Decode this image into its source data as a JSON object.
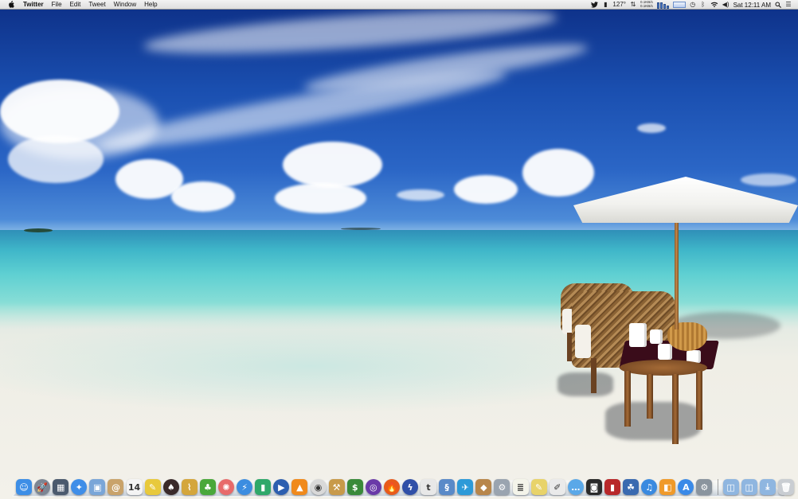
{
  "menubar": {
    "app_name": "Twitter",
    "menus": [
      "File",
      "Edit",
      "Tweet",
      "Window",
      "Help"
    ],
    "status": {
      "temperature": "127°",
      "net_up": "0.1KB/s",
      "net_down": "0.1KB/s",
      "clock": "Sat 12:11 AM"
    }
  },
  "dock": {
    "apps": [
      {
        "name": "finder-icon",
        "glyph": "☺",
        "bg": "#3d8ee6",
        "round": false
      },
      {
        "name": "launchpad-icon",
        "glyph": "🚀",
        "bg": "#7c8593",
        "round": true
      },
      {
        "name": "mission-control-icon",
        "glyph": "▦",
        "bg": "#4b5a6e",
        "round": false
      },
      {
        "name": "safari-icon",
        "glyph": "✦",
        "bg": "#3f8ee8",
        "round": true
      },
      {
        "name": "preview-icon",
        "glyph": "▣",
        "bg": "#7aa6d8",
        "round": false
      },
      {
        "name": "address-book-icon",
        "glyph": "@",
        "bg": "#c9a36b",
        "round": false
      },
      {
        "name": "calendar-icon",
        "glyph": "14",
        "bg": "#f4f4f4",
        "round": false
      },
      {
        "name": "stickies-icon",
        "glyph": "✎",
        "bg": "#e8c93c",
        "round": false
      },
      {
        "name": "alfred-hat-icon",
        "glyph": "♠",
        "bg": "#3a2a2a",
        "round": true
      },
      {
        "name": "paperclip-icon",
        "glyph": "⌇",
        "bg": "#d4a63c",
        "round": false
      },
      {
        "name": "evernote-icon",
        "glyph": "♣",
        "bg": "#4aa83a",
        "round": false
      },
      {
        "name": "pinwheel-icon",
        "glyph": "✺",
        "bg": "#e86a6a",
        "round": true
      },
      {
        "name": "reeder-icon",
        "glyph": "⚡",
        "bg": "#3c8de0",
        "round": true
      },
      {
        "name": "bottle-icon",
        "glyph": "▮",
        "bg": "#2fa86a",
        "round": false
      },
      {
        "name": "quicktime-icon",
        "glyph": "▶",
        "bg": "#2d5fb0",
        "round": true
      },
      {
        "name": "vlc-icon",
        "glyph": "▲",
        "bg": "#f08a1c",
        "round": false
      },
      {
        "name": "chrome-icon",
        "glyph": "◉",
        "bg": "#d9d9d9",
        "round": true
      },
      {
        "name": "hammer-icon",
        "glyph": "⚒",
        "bg": "#c89a4a",
        "round": false
      },
      {
        "name": "money-icon",
        "glyph": "$",
        "bg": "#3a8a3a",
        "round": false
      },
      {
        "name": "dvd-icon",
        "glyph": "◎",
        "bg": "#6a3aa8",
        "round": true
      },
      {
        "name": "firefox-icon",
        "glyph": "🔥",
        "bg": "#e85a1c",
        "round": true
      },
      {
        "name": "thunder-icon",
        "glyph": "ϟ",
        "bg": "#3050a8",
        "round": true
      },
      {
        "name": "textedit-icon",
        "glyph": "t",
        "bg": "#e8e8e8",
        "round": false
      },
      {
        "name": "dna-icon",
        "glyph": "§",
        "bg": "#5a8ac8",
        "round": false
      },
      {
        "name": "twitter-icon",
        "glyph": "✈",
        "bg": "#2d9ad8",
        "round": false
      },
      {
        "name": "package-icon",
        "glyph": "◆",
        "bg": "#b8864a",
        "round": false
      },
      {
        "name": "utility-icon",
        "glyph": "⚙",
        "bg": "#9aa4b0",
        "round": false
      },
      {
        "name": "notepad-icon",
        "glyph": "≣",
        "bg": "#f4f4ea",
        "round": false
      },
      {
        "name": "notes-icon",
        "glyph": "✎",
        "bg": "#e8d36a",
        "round": false
      },
      {
        "name": "editor-icon",
        "glyph": "✐",
        "bg": "#eaeaea",
        "round": false
      },
      {
        "name": "messages-icon",
        "glyph": "…",
        "bg": "#5aa8e8",
        "round": true
      },
      {
        "name": "photo-booth-icon",
        "glyph": "◙",
        "bg": "#2a2a2a",
        "round": false
      },
      {
        "name": "photoshop-icon",
        "glyph": "▮",
        "bg": "#b8282a",
        "round": false
      },
      {
        "name": "photos-icon",
        "glyph": "☘",
        "bg": "#3a6ab0",
        "round": false
      },
      {
        "name": "itunes-icon",
        "glyph": "♫",
        "bg": "#3a8ae0",
        "round": true
      },
      {
        "name": "ibooks-icon",
        "glyph": "◧",
        "bg": "#f09a2a",
        "round": false
      },
      {
        "name": "app-store-icon",
        "glyph": "A",
        "bg": "#3a8ae8",
        "round": true
      },
      {
        "name": "system-preferences-icon",
        "glyph": "⚙",
        "bg": "#8a949e",
        "round": false
      }
    ],
    "stacks": [
      {
        "name": "applications-folder-icon",
        "glyph": "◫",
        "bg": "#8fb6e0"
      },
      {
        "name": "documents-folder-icon",
        "glyph": "◫",
        "bg": "#8fb6e0"
      },
      {
        "name": "downloads-folder-icon",
        "glyph": "⤓",
        "bg": "#8fb6e0"
      },
      {
        "name": "trash-icon",
        "glyph": "🗑",
        "bg": "#c9cdd2"
      }
    ]
  }
}
